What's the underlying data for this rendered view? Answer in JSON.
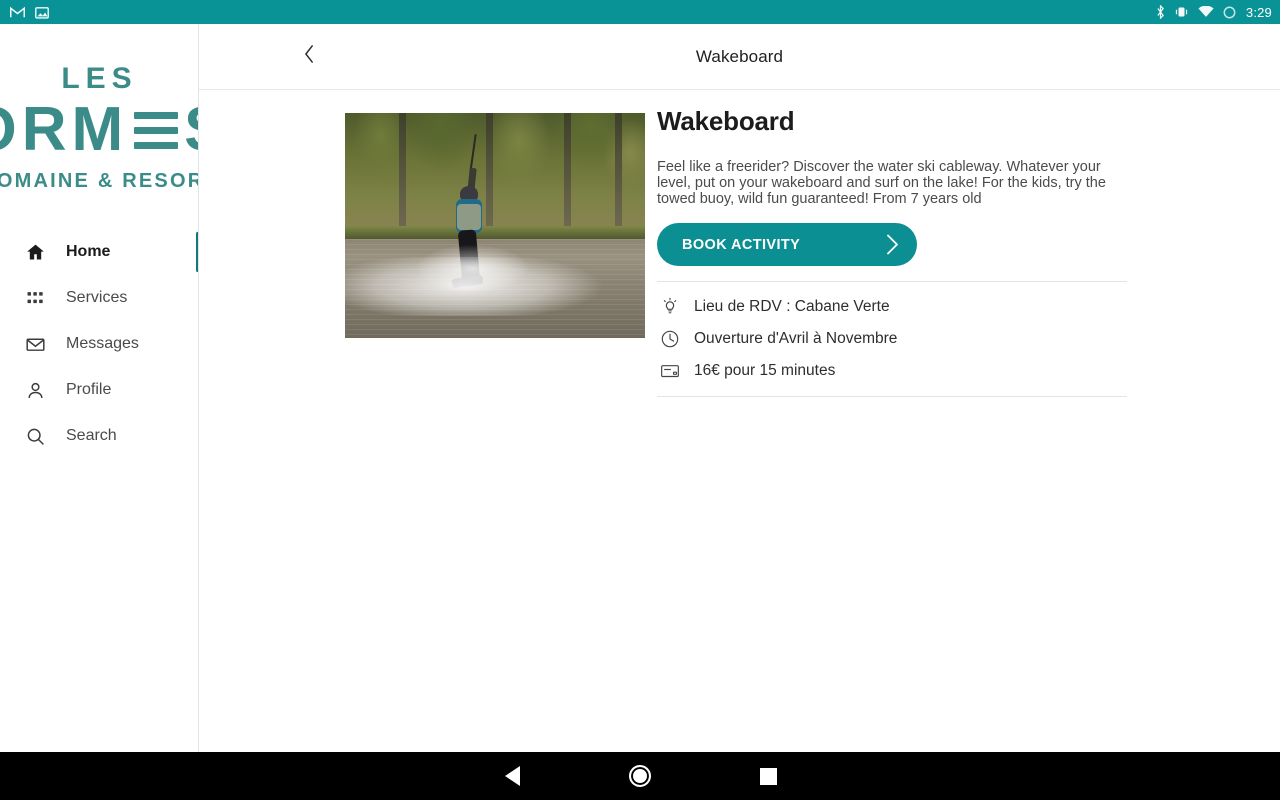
{
  "statusbar": {
    "time": "3:29",
    "left_icons": [
      {
        "name": "gmail-icon",
        "glyph": "M"
      },
      {
        "name": "photo-notification-icon",
        "glyph": "image"
      }
    ],
    "right_icons": [
      {
        "name": "bluetooth-icon"
      },
      {
        "name": "vibrate-icon"
      },
      {
        "name": "wifi-icon"
      },
      {
        "name": "battery-icon"
      }
    ],
    "background_color": "#0a9396"
  },
  "brand": {
    "line1": "LES",
    "line2_a": "O",
    "line2_b": "RM",
    "line2_c": "S",
    "tagline": "DOMAINE & RESORT",
    "color": "#3b8c89"
  },
  "sidebar": {
    "items": [
      {
        "label": "Home",
        "icon": "home-icon",
        "active": true
      },
      {
        "label": "Services",
        "icon": "grid-icon",
        "active": false
      },
      {
        "label": "Messages",
        "icon": "envelope-icon",
        "active": false
      },
      {
        "label": "Profile",
        "icon": "person-icon",
        "active": false
      },
      {
        "label": "Search",
        "icon": "search-icon",
        "active": false
      }
    ],
    "active_indicator_color": "#12787c"
  },
  "header": {
    "title": "Wakeboard",
    "back_icon": "chevron-left-icon"
  },
  "activity": {
    "title": "Wakeboard",
    "description": "Feel like a freerider? Discover the water ski cableway. Whatever your level, put on your wakeboard and surf on the lake! For the kids, try the towed buoy, wild fun guaranteed! From 7 years old",
    "image_alt": "Wakeboarder riding on the lake",
    "book_button": {
      "label": "BOOK ACTIVITY",
      "icon": "chevron-right-icon",
      "color": "#0c8f92"
    },
    "info": [
      {
        "icon": "lightbulb-icon",
        "text": "Lieu de RDV : Cabane Verte"
      },
      {
        "icon": "clock-icon",
        "text": "Ouverture d'Avril à Novembre"
      },
      {
        "icon": "credit-card-icon",
        "text": "16€ pour 15 minutes"
      }
    ]
  },
  "navbar": {
    "back_label": "Back",
    "home_label": "Home",
    "recents_label": "Recents"
  }
}
